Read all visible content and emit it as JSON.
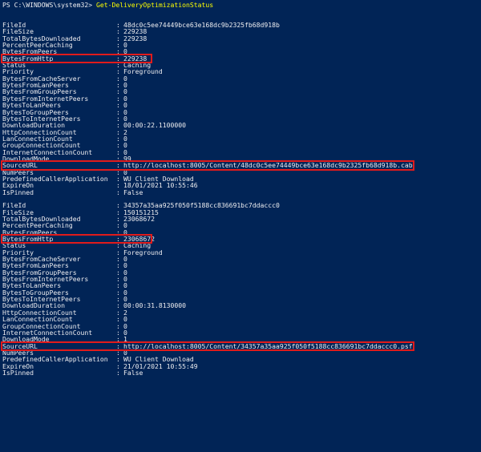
{
  "prompt": "PS C:\\WINDOWS\\system32>",
  "command": "Get-DeliveryOptimizationStatus",
  "records": [
    {
      "fields": [
        {
          "key": "FileId",
          "value": "48dc0c5ee74449bce63e168dc9b2325fb68d918b"
        },
        {
          "key": "FileSize",
          "value": "229238"
        },
        {
          "key": "TotalBytesDownloaded",
          "value": "229238"
        },
        {
          "key": "PercentPeerCaching",
          "value": "0"
        },
        {
          "key": "BytesFromPeers",
          "value": "0"
        },
        {
          "key": "BytesFromHttp",
          "value": "229238",
          "highlight": "short"
        },
        {
          "key": "Status",
          "value": "Caching"
        },
        {
          "key": "Priority",
          "value": "Foreground"
        },
        {
          "key": "BytesFromCacheServer",
          "value": "0"
        },
        {
          "key": "BytesFromLanPeers",
          "value": "0"
        },
        {
          "key": "BytesFromGroupPeers",
          "value": "0"
        },
        {
          "key": "BytesFromInternetPeers",
          "value": "0"
        },
        {
          "key": "BytesToLanPeers",
          "value": "0"
        },
        {
          "key": "BytesToGroupPeers",
          "value": "0"
        },
        {
          "key": "BytesToInternetPeers",
          "value": "0"
        },
        {
          "key": "DownloadDuration",
          "value": "00:00:22.1100000"
        },
        {
          "key": "HttpConnectionCount",
          "value": "2"
        },
        {
          "key": "LanConnectionCount",
          "value": "0"
        },
        {
          "key": "GroupConnectionCount",
          "value": "0"
        },
        {
          "key": "InternetConnectionCount",
          "value": "0"
        },
        {
          "key": "DownloadMode",
          "value": "99"
        },
        {
          "key": "SourceURL",
          "value": "http://localhost:8005/Content/48dc0c5ee74449bce63e168dc9b2325fb68d918b.cab",
          "highlight": "long"
        },
        {
          "key": "NumPeers",
          "value": "0"
        },
        {
          "key": "PredefinedCallerApplication",
          "value": "WU Client Download"
        },
        {
          "key": "ExpireOn",
          "value": "18/01/2021 10:55:46"
        },
        {
          "key": "IsPinned",
          "value": "False"
        }
      ]
    },
    {
      "fields": [
        {
          "key": "FileId",
          "value": "34357a35aa925f050f5188cc836691bc7ddaccc0"
        },
        {
          "key": "FileSize",
          "value": "150151215"
        },
        {
          "key": "TotalBytesDownloaded",
          "value": "23068672"
        },
        {
          "key": "PercentPeerCaching",
          "value": "0"
        },
        {
          "key": "BytesFromPeers",
          "value": "0"
        },
        {
          "key": "BytesFromHttp",
          "value": "23068672",
          "highlight": "short"
        },
        {
          "key": "Status",
          "value": "Caching"
        },
        {
          "key": "Priority",
          "value": "Foreground"
        },
        {
          "key": "BytesFromCacheServer",
          "value": "0"
        },
        {
          "key": "BytesFromLanPeers",
          "value": "0"
        },
        {
          "key": "BytesFromGroupPeers",
          "value": "0"
        },
        {
          "key": "BytesFromInternetPeers",
          "value": "0"
        },
        {
          "key": "BytesToLanPeers",
          "value": "0"
        },
        {
          "key": "BytesToGroupPeers",
          "value": "0"
        },
        {
          "key": "BytesToInternetPeers",
          "value": "0"
        },
        {
          "key": "DownloadDuration",
          "value": "00:00:31.8130000"
        },
        {
          "key": "HttpConnectionCount",
          "value": "2"
        },
        {
          "key": "LanConnectionCount",
          "value": "0"
        },
        {
          "key": "GroupConnectionCount",
          "value": "0"
        },
        {
          "key": "InternetConnectionCount",
          "value": "0"
        },
        {
          "key": "DownloadMode",
          "value": "1"
        },
        {
          "key": "SourceURL",
          "value": "http://localhost:8005/Content/34357a35aa925f050f5188cc836691bc7ddaccc0.psf",
          "highlight": "long"
        },
        {
          "key": "NumPeers",
          "value": "0"
        },
        {
          "key": "PredefinedCallerApplication",
          "value": "WU Client Download"
        },
        {
          "key": "ExpireOn",
          "value": "21/01/2021 10:55:49"
        },
        {
          "key": "IsPinned",
          "value": "False"
        }
      ]
    }
  ]
}
